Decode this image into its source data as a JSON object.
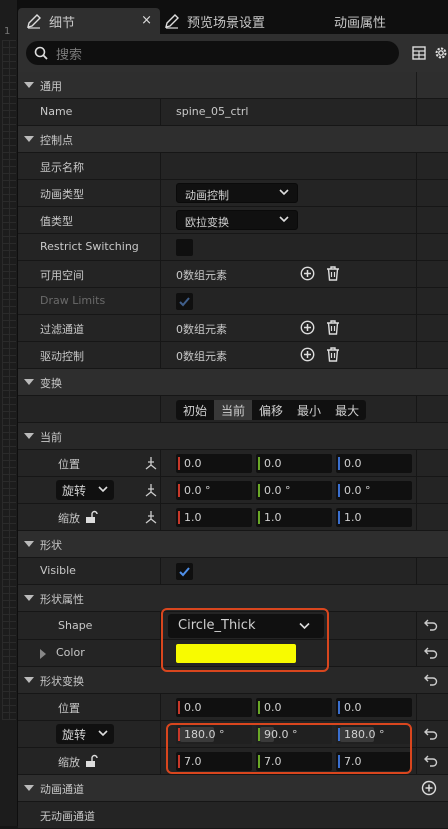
{
  "tabs": [
    {
      "label": "细节",
      "close": "×",
      "icon": "pencil-icon"
    },
    {
      "label": "预览场景设置",
      "icon": "pencil-icon"
    },
    {
      "label": "动画属性"
    }
  ],
  "left_strip_char": "1",
  "search": {
    "placeholder": "搜索"
  },
  "sections": {
    "general": {
      "title": "通用",
      "name_label": "Name",
      "name_value": "spine_05_ctrl"
    },
    "control": {
      "title": "控制点",
      "display_name": "显示名称",
      "anim_type_label": "动画类型",
      "anim_type_value": "动画控制",
      "value_type_label": "值类型",
      "value_type_value": "欧拉变换",
      "restrict_label": "Restrict Switching",
      "restrict_checked": false,
      "space_label": "可用空间",
      "space_value": "0数组元素",
      "draw_limits_label": "Draw Limits",
      "draw_limits_checked": true,
      "filter_label": "过滤通道",
      "filter_value": "0数组元素",
      "driven_label": "驱动控制",
      "driven_value": "0数组元素"
    },
    "transform": {
      "title": "变换",
      "segments": [
        "初始",
        "当前",
        "偏移",
        "最小",
        "最大"
      ],
      "active_segment": "当前",
      "current_title": "当前",
      "position_label": "位置",
      "position": [
        "0.0",
        "0.0",
        "0.0"
      ],
      "rotation_label": "旋转",
      "rotation": [
        "0.0 °",
        "0.0 °",
        "0.0 °"
      ],
      "scale_label": "缩放",
      "scale": [
        "1.0",
        "1.0",
        "1.0"
      ]
    },
    "shape": {
      "title": "形状",
      "visible_label": "Visible",
      "visible_checked": true
    },
    "shape_props": {
      "title": "形状属性",
      "shape_label": "Shape",
      "shape_value": "Circle_Thick",
      "color_label": "Color",
      "color_hex": "#f8fb00"
    },
    "shape_transform": {
      "title": "形状变换",
      "position_label": "位置",
      "position": [
        "0.0",
        "0.0",
        "0.0"
      ],
      "rotation_label": "旋转",
      "rotation": [
        "180.0 °",
        "90.0 °",
        "180.0 °"
      ],
      "scale_label": "缩放",
      "scale": [
        "7.0",
        "7.0",
        "7.0"
      ]
    },
    "anim_channel": {
      "title": "动画通道",
      "empty": "无动画通道"
    }
  },
  "axis_colors": {
    "x": "#c8382a",
    "y": "#6aa827",
    "z": "#3a6fcf"
  },
  "highlight_color": "#d9461e"
}
